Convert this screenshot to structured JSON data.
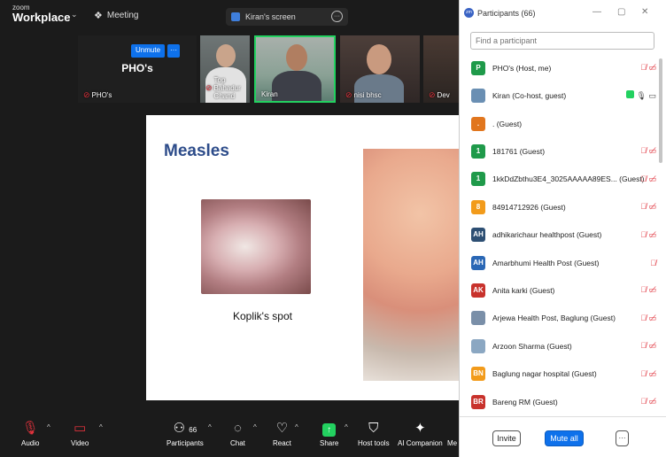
{
  "app": {
    "brand_small": "zoom",
    "brand_big": "Workplace",
    "meeting_label": "Meeting",
    "screen_label": "Kiran's screen"
  },
  "video_strip": {
    "main_tile_name": "PHO's",
    "main_tile_label": "PHO's",
    "unmute_label": "Unmute",
    "more_label": "···",
    "tiles": [
      {
        "name": "Top Bahadur Chand"
      },
      {
        "name": "Kiran"
      },
      {
        "name": "nisi bhsc"
      },
      {
        "name": "Dev"
      }
    ]
  },
  "slide": {
    "title": "Measles",
    "caption": "Koplik's spot"
  },
  "toolbar": {
    "audio": "Audio",
    "video": "Video",
    "participants": "Participants",
    "participants_count": "66",
    "chat": "Chat",
    "react": "React",
    "share": "Share",
    "host_tools": "Host tools",
    "ai_companion": "AI Companion",
    "more": "Me"
  },
  "panel": {
    "title": "Participants (66)",
    "search_placeholder": "Find a participant",
    "participants": [
      {
        "initials": "P",
        "color": "#1f9a4a",
        "name": "PHO's (Host, me)",
        "status": "muted-video-off"
      },
      {
        "initials": "",
        "color": "#6a8fb3",
        "name": "Kiran (Co-host, guest)",
        "status": "sharing"
      },
      {
        "initials": ".",
        "color": "#e1761e",
        "name": ". (Guest)",
        "status": ""
      },
      {
        "initials": "1",
        "color": "#1f9a4a",
        "name": "181761 (Guest)",
        "status": "muted-video-off"
      },
      {
        "initials": "1",
        "color": "#1f9a4a",
        "name": "1kkDdZbthu3E4_3025AAAAA89ES... (Guest)",
        "status": "muted-video-off"
      },
      {
        "initials": "8",
        "color": "#f29b1b",
        "name": "84914712926 (Guest)",
        "status": "muted-video-off"
      },
      {
        "initials": "AH",
        "color": "#2d4f73",
        "name": "adhikarichaur healthpost (Guest)",
        "status": "muted-video-off"
      },
      {
        "initials": "AH",
        "color": "#2a67b5",
        "name": "Amarbhumi Health Post (Guest)",
        "status": "muted"
      },
      {
        "initials": "AK",
        "color": "#c8322c",
        "name": "Anita karki (Guest)",
        "status": "muted-video-off"
      },
      {
        "initials": "",
        "color": "#7a8fa8",
        "name": "Arjewa Health Post, Baglung (Guest)",
        "status": "muted-video-off"
      },
      {
        "initials": "",
        "color": "#8ba7c2",
        "name": "Arzoon Sharma (Guest)",
        "status": "muted-video-off"
      },
      {
        "initials": "BN",
        "color": "#f29b1b",
        "name": "Baglung nagar hospital (Guest)",
        "status": "muted-video-off"
      },
      {
        "initials": "BR",
        "color": "#c8322c",
        "name": "Bareng RM (Guest)",
        "status": "muted-video-off"
      }
    ],
    "invite_label": "Invite",
    "mute_all_label": "Mute all",
    "more_label": "···"
  }
}
